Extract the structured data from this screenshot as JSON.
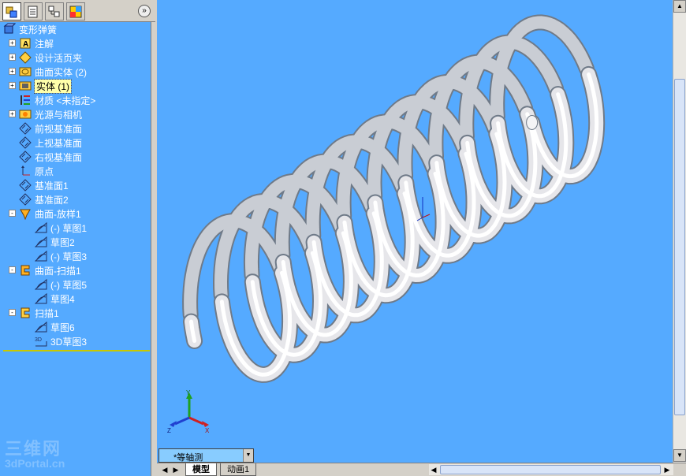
{
  "pane_tabs": [
    {
      "name": "feature-manager",
      "icon": "feature-tree-icon"
    },
    {
      "name": "property-manager",
      "icon": "property-icon"
    },
    {
      "name": "configuration-manager",
      "icon": "configuration-icon"
    },
    {
      "name": "display-manager",
      "icon": "display-icon"
    }
  ],
  "collapse_glyph": "»",
  "tree": {
    "root": {
      "label": "变形弹簧",
      "icon": "part-icon"
    },
    "items": [
      {
        "label": "注解",
        "icon": "annotation-icon",
        "expander": "+"
      },
      {
        "label": "设计活页夹",
        "icon": "design-binder-icon",
        "expander": "+"
      },
      {
        "label": "曲面实体 (2)",
        "icon": "surface-bodies-icon",
        "expander": "+"
      },
      {
        "label": "实体 (1)",
        "icon": "solid-bodies-icon",
        "expander": "+",
        "highlighted": true
      },
      {
        "label": "材质 <未指定>",
        "icon": "material-icon",
        "expander": ""
      },
      {
        "label": "光源与相机",
        "icon": "lights-cameras-icon",
        "expander": "+"
      },
      {
        "label": "前视基准面",
        "icon": "plane-icon",
        "expander": ""
      },
      {
        "label": "上视基准面",
        "icon": "plane-icon",
        "expander": ""
      },
      {
        "label": "右视基准面",
        "icon": "plane-icon",
        "expander": ""
      },
      {
        "label": "原点",
        "icon": "origin-icon",
        "expander": ""
      },
      {
        "label": "基准面1",
        "icon": "plane-icon",
        "expander": ""
      },
      {
        "label": "基准面2",
        "icon": "plane-icon",
        "expander": ""
      },
      {
        "label": "曲面-放样1",
        "icon": "surface-loft-icon",
        "expander": "-"
      },
      {
        "label": "(-) 草图1",
        "icon": "sketch-icon",
        "expander": "",
        "child": true
      },
      {
        "label": "草图2",
        "icon": "sketch-icon",
        "expander": "",
        "child": true
      },
      {
        "label": "(-) 草图3",
        "icon": "sketch-icon",
        "expander": "",
        "child": true
      },
      {
        "label": "曲面-扫描1",
        "icon": "surface-sweep-icon",
        "expander": "-"
      },
      {
        "label": "(-) 草图5",
        "icon": "sketch-icon",
        "expander": "",
        "child": true
      },
      {
        "label": "草图4",
        "icon": "sketch-icon",
        "expander": "",
        "child": true
      },
      {
        "label": "扫描1",
        "icon": "sweep-icon",
        "expander": "-"
      },
      {
        "label": "草图6",
        "icon": "sketch-icon",
        "expander": "",
        "child": true
      },
      {
        "label": "3D草图3",
        "icon": "3d-sketch-icon",
        "expander": "",
        "child": true
      }
    ]
  },
  "watermark": {
    "big": "三维网",
    "small": "3dPortal.cn"
  },
  "view_orientation": {
    "label": "*等轴测",
    "arrow": "▼"
  },
  "bottom_tabs": [
    {
      "label": "模型",
      "active": true
    },
    {
      "label": "动画1",
      "active": false
    }
  ],
  "nav_arrows": {
    "left": "◀",
    "right": "▶"
  },
  "scroll_arrows": {
    "up": "▲",
    "down": "▼",
    "left": "◀",
    "right": "▶"
  },
  "triad": {
    "x": "X",
    "y": "Y",
    "z": "Z"
  },
  "colors": {
    "background": "#55aaff",
    "spring": "#e6e6ea",
    "highlight": "#ffffaa"
  }
}
